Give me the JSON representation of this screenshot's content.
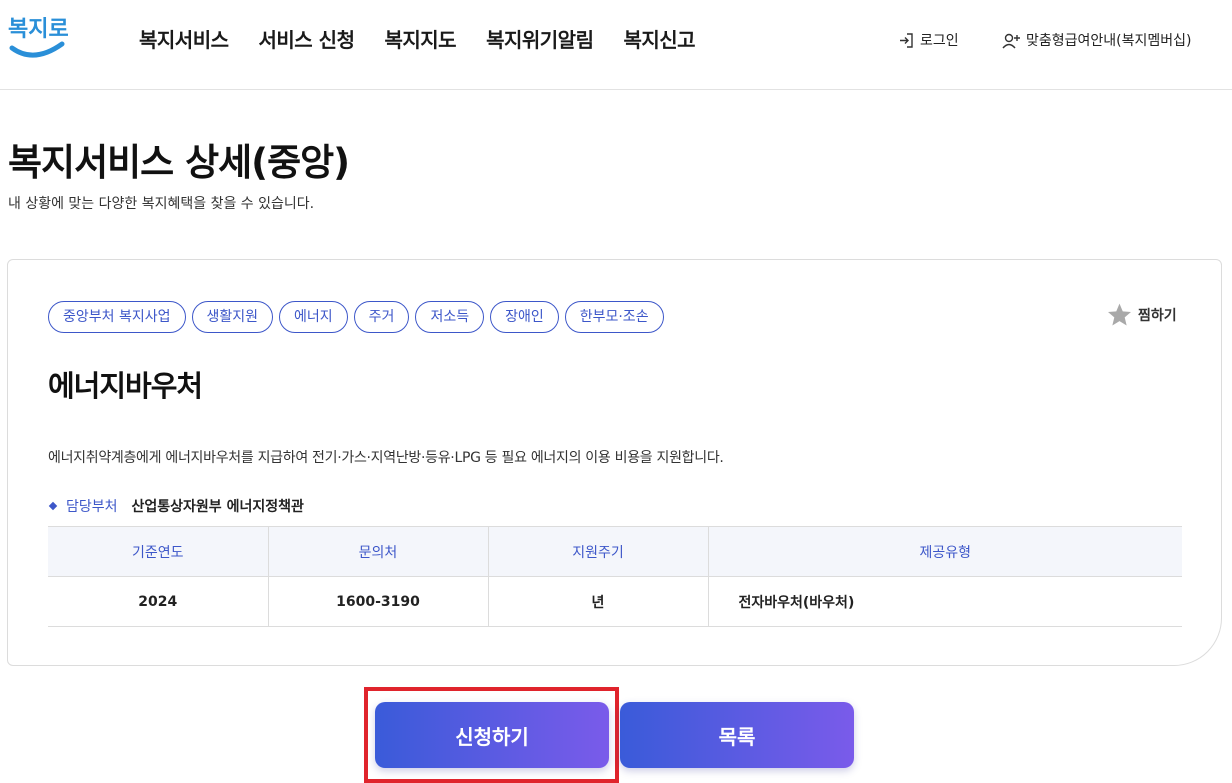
{
  "header": {
    "logo_text": "복지로",
    "nav": [
      "복지서비스",
      "서비스 신청",
      "복지지도",
      "복지위기알림",
      "복지신고"
    ],
    "login_label": "로그인",
    "member_label": "맞춤형급여안내(복지멤버십)"
  },
  "page": {
    "title": "복지서비스 상세(중앙)",
    "subtitle": "내 상황에 맞는 다양한 복지혜택을 찾을 수 있습니다."
  },
  "service": {
    "tags": [
      "중앙부처 복지사업",
      "생활지원",
      "에너지",
      "주거",
      "저소득",
      "장애인",
      "한부모·조손"
    ],
    "favorite_label": "찜하기",
    "title": "에너지바우처",
    "description": "에너지취약계층에게 에너지바우처를 지급하여 전기·가스·지역난방·등유·LPG 등 필요 에너지의 이용 비용을 지원합니다.",
    "dept_label": "담당부처",
    "dept_value": "산업통상자원부 에너지정책관",
    "table": {
      "headers": [
        "기준연도",
        "문의처",
        "지원주기",
        "제공유형"
      ],
      "row": [
        "2024",
        "1600-3190",
        "년",
        "전자바우처(바우처)"
      ]
    }
  },
  "actions": {
    "apply_label": "신청하기",
    "list_label": "목록"
  },
  "colors": {
    "accent": "#3d57c9",
    "button_gradient_start": "#3a5bd9",
    "button_gradient_end": "#7a5bea",
    "highlight": "#e0242c"
  }
}
